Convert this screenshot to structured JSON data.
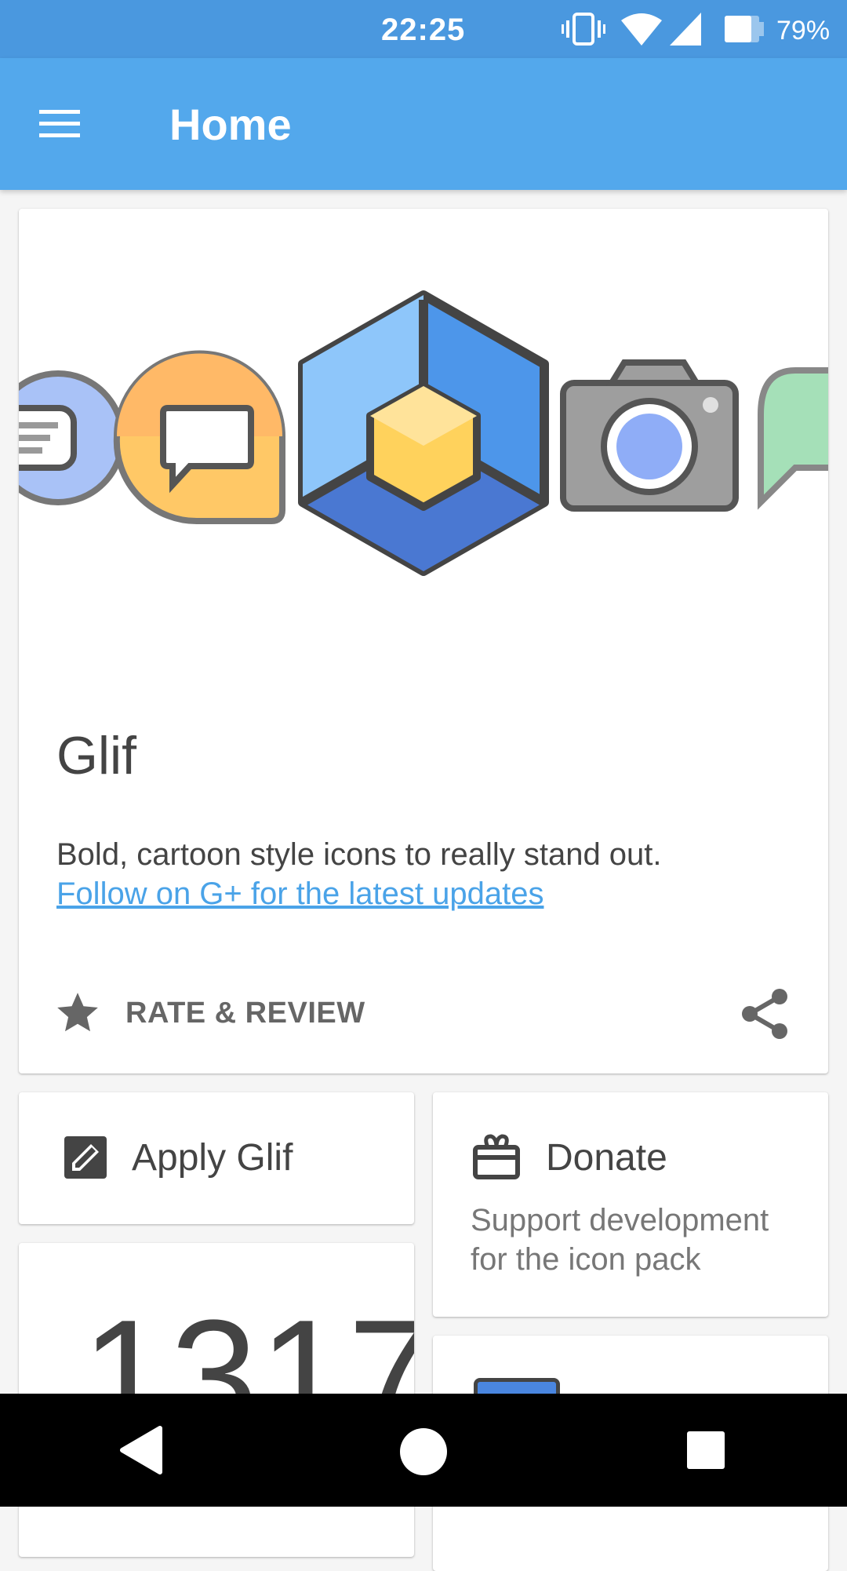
{
  "status_bar": {
    "time": "22:25",
    "battery_percent": "79%",
    "icons": [
      "vibrate-icon",
      "wifi-icon",
      "signal-icon",
      "battery-icon"
    ]
  },
  "app_bar": {
    "title": "Home",
    "menu_icon": "hamburger-menu-icon"
  },
  "hero": {
    "title": "Glif",
    "description": "Bold, cartoon style icons to really stand out.",
    "link": "Follow on G+ for the latest updates",
    "rate_label": "RATE & REVIEW",
    "rate_icon": "star-icon",
    "share_icon": "share-icon",
    "art_icons": [
      "messages-icon",
      "chat-bubble-icon",
      "cube-launcher-icon",
      "camera-icon",
      "hangouts-icon"
    ]
  },
  "apply": {
    "label": "Apply Glif",
    "icon": "apply-edit-icon"
  },
  "donate": {
    "label": "Donate",
    "description": "Support development for the icon pack",
    "icon": "gift-icon"
  },
  "stats": {
    "count": "1317"
  },
  "nav_bar": {
    "back_icon": "back-triangle-icon",
    "home_icon": "home-circle-icon",
    "recents_icon": "recents-square-icon"
  },
  "colors": {
    "status_bar": "#4a98df",
    "app_bar": "#53a8ec",
    "link": "#4aa3e8",
    "background": "#f5f5f5"
  }
}
